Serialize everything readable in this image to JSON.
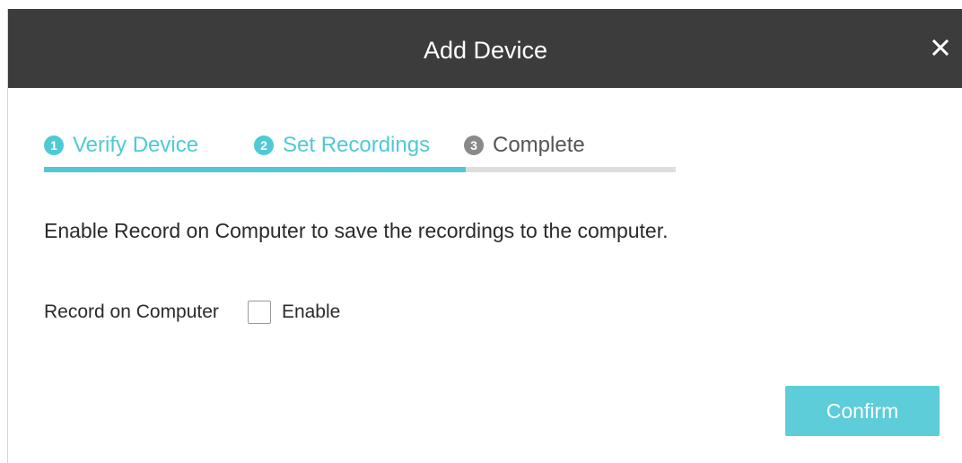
{
  "dialog": {
    "title": "Add Device",
    "close_icon": "close-icon"
  },
  "steps": [
    {
      "number": "1",
      "label": "Verify Device",
      "state": "active"
    },
    {
      "number": "2",
      "label": "Set Recordings",
      "state": "active"
    },
    {
      "number": "3",
      "label": "Complete",
      "state": "inactive"
    }
  ],
  "progress": {
    "completed_fraction": 0.667
  },
  "content": {
    "description": "Enable Record on Computer to save the recordings to the computer.",
    "record_on_computer": {
      "label": "Record on Computer",
      "checkbox_label": "Enable",
      "checked": false
    }
  },
  "footer": {
    "confirm_label": "Confirm"
  },
  "colors": {
    "accent": "#4fc9d6",
    "titlebar": "#3c3c3c",
    "inactive_step": "#8a8a8a",
    "track": "#dedede",
    "button": "#5ccdd9"
  }
}
